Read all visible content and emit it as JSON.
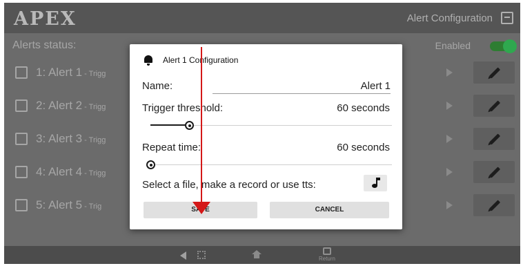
{
  "app": {
    "logo": "APEX",
    "title": "Alert Configuration",
    "status_label": "Alerts status:",
    "enabled_label": "Enabled",
    "enabled": true,
    "accent_color": "#2fa84f"
  },
  "alerts": [
    {
      "label": "1: Alert 1",
      "sub": " - Trigg"
    },
    {
      "label": "2: Alert 2",
      "sub": " - Trigg"
    },
    {
      "label": "3: Alert 3",
      "sub": " - Trigg"
    },
    {
      "label": "4: Alert 4",
      "sub": " - Trigg"
    },
    {
      "label": "5: Alert 5",
      "sub": " - Trig"
    }
  ],
  "dialog": {
    "title": "Alert 1 Configuration",
    "name_label": "Name:",
    "name_value": "Alert 1",
    "trigger_label": "Trigger threshold:",
    "trigger_value": "60 seconds",
    "trigger_fraction": 0.16,
    "repeat_label": "Repeat time:",
    "repeat_value": "60 seconds",
    "repeat_fraction": 0.0,
    "select_prompt": "Select a file, make a record or use tts:",
    "save_label": "SAVE",
    "cancel_label": "CANCEL"
  },
  "navbar": {
    "return_label": "Return"
  },
  "icons": {
    "exit": "exit-icon",
    "bell": "bell-icon",
    "music": "music-note-icon",
    "edit": "pencil-icon",
    "play": "play-icon",
    "back": "back-icon",
    "home": "home-icon"
  },
  "annotation_color": "#d41818"
}
